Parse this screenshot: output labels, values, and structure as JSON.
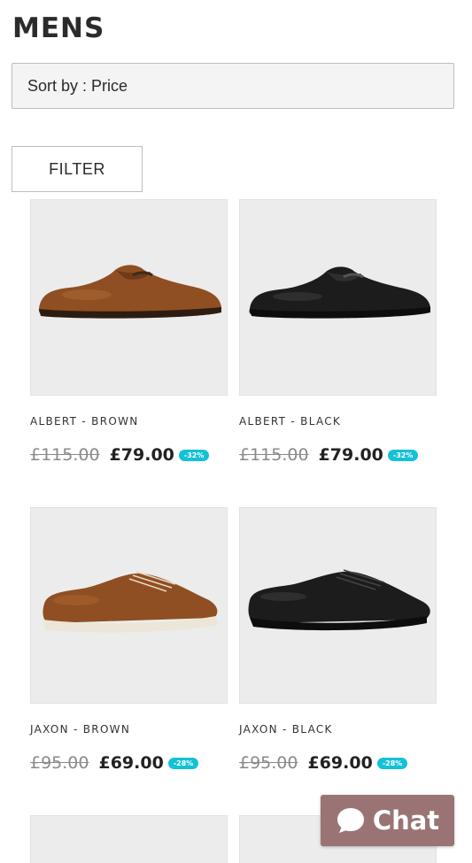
{
  "header": {
    "title": "MENS"
  },
  "sort": {
    "label": "Sort by : Price"
  },
  "filter": {
    "label": "FILTER"
  },
  "products": [
    {
      "name": "ALBERT - BROWN",
      "old_price": "£115.00",
      "new_price": "£79.00",
      "discount": "-32%",
      "color": "brown",
      "style": "loafer"
    },
    {
      "name": "ALBERT - BLACK",
      "old_price": "£115.00",
      "new_price": "£79.00",
      "discount": "-32%",
      "color": "black",
      "style": "loafer"
    },
    {
      "name": "JAXON - BROWN",
      "old_price": "£95.00",
      "new_price": "£69.00",
      "discount": "-28%",
      "color": "brown",
      "style": "sneaker"
    },
    {
      "name": "JAXON - BLACK",
      "old_price": "£95.00",
      "new_price": "£69.00",
      "discount": "-28%",
      "color": "black",
      "style": "sneaker"
    }
  ],
  "chat": {
    "label": "Chat",
    "icon": "chat-bubble-icon"
  },
  "colors": {
    "brown_shoe": "#8f4f22",
    "black_shoe": "#1c1c1c",
    "badge": "#14c1d6",
    "chat_bg": "#9a7474"
  }
}
